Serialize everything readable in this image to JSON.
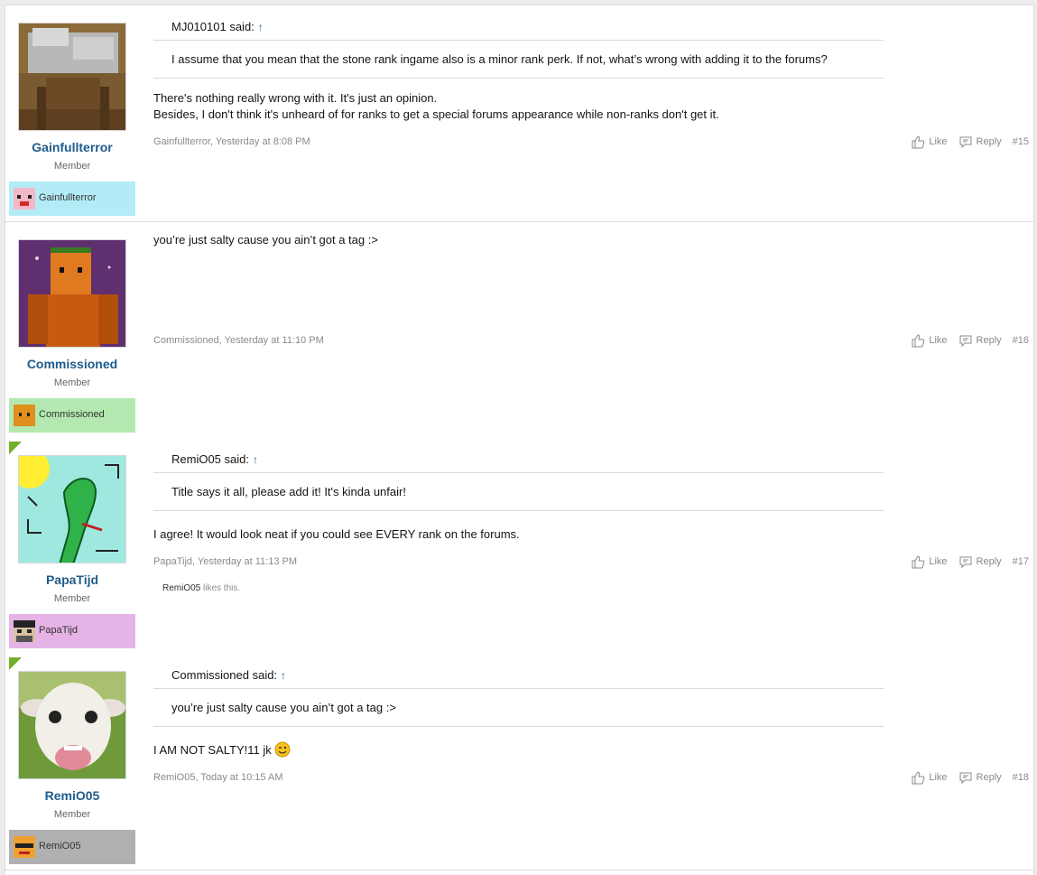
{
  "posts": [
    {
      "username": "Gainfullterror",
      "user_title": "Member",
      "tag": {
        "label": "Gainfullterror",
        "color": "#b3ecf6",
        "icon": "pig-face-icon"
      },
      "quote": {
        "author": "MJ010101 said:",
        "arrow": "↑",
        "text": "I assume that you mean that the stone rank ingame also is a minor rank perk. If not, what’s wrong with adding it to the forums?"
      },
      "message": [
        "There's nothing really wrong with it. It's just an opinion.",
        "Besides, I don't think it's unheard of for ranks to get a special forums appearance while non-ranks don't get it."
      ],
      "meta": "Gainfullterror, Yesterday at 8:08 PM",
      "like_label": "Like",
      "reply_label": "Reply",
      "number": "#15"
    },
    {
      "username": "Commissioned",
      "user_title": "Member",
      "tag": {
        "label": "Commissioned",
        "color": "#b3e9b0",
        "icon": "orange-block-face-icon"
      },
      "message": [
        "you’re just salty cause you ain’t got a tag :>"
      ],
      "meta": "Commissioned, Yesterday at 11:10 PM",
      "like_label": "Like",
      "reply_label": "Reply",
      "number": "#16"
    },
    {
      "username": "PapaTijd",
      "user_title": "Member",
      "tag": {
        "label": "PapaTijd",
        "color": "#e6b3e6",
        "icon": "skin-face-icon"
      },
      "quote": {
        "author": "RemiO05 said:",
        "arrow": "↑",
        "text": "Title says it all, please add it! It's kinda unfair!"
      },
      "message": [
        "I agree! It would look neat if you could see EVERY rank on the forums."
      ],
      "meta": "PapaTijd, Yesterday at 11:13 PM",
      "like_label": "Like",
      "reply_label": "Reply",
      "number": "#17",
      "likes": {
        "liker": "RemiO05",
        "suffix": " likes this."
      }
    },
    {
      "username": "RemiO05",
      "user_title": "Member",
      "tag": {
        "label": "RemiO05",
        "color": "#b0b0b0",
        "icon": "sunglasses-face-icon"
      },
      "quote": {
        "author": "Commissioned said:",
        "arrow": "↑",
        "text": "you’re just salty cause you ain’t got a tag :>"
      },
      "message": [
        "I AM NOT SALTY!11 jk"
      ],
      "meta": "RemiO05, Today at 10:15 AM",
      "like_label": "Like",
      "reply_label": "Reply",
      "number": "#18"
    }
  ],
  "icons": {
    "like": "thumbs-up-icon",
    "reply": "speech-bubble-icon",
    "smiley": "wink-smiley-icon"
  },
  "colors": {
    "link": "#1e5b8c",
    "meta": "#8a8a8a",
    "new_post_corner": "#70b02b"
  }
}
